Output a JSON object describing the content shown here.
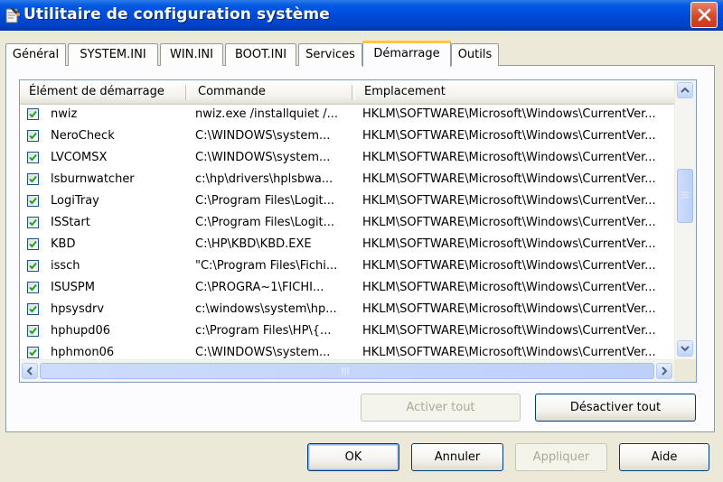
{
  "window": {
    "title": "Utilitaire de configuration système"
  },
  "tabs": [
    {
      "label": "Général"
    },
    {
      "label": "SYSTEM.INI"
    },
    {
      "label": "WIN.INI"
    },
    {
      "label": "BOOT.INI"
    },
    {
      "label": "Services"
    },
    {
      "label": "Démarrage",
      "active": true
    },
    {
      "label": "Outils"
    }
  ],
  "startup_list": {
    "columns": [
      "Élément de démarrage",
      "Commande",
      "Emplacement"
    ],
    "rows": [
      {
        "checked": true,
        "item": "nwiz",
        "command": "nwiz.exe /installquiet /...",
        "location": "HKLM\\SOFTWARE\\Microsoft\\Windows\\CurrentVer..."
      },
      {
        "checked": true,
        "item": "NeroCheck",
        "command": "C:\\WINDOWS\\system...",
        "location": "HKLM\\SOFTWARE\\Microsoft\\Windows\\CurrentVer..."
      },
      {
        "checked": true,
        "item": "LVCOMSX",
        "command": "C:\\WINDOWS\\system...",
        "location": "HKLM\\SOFTWARE\\Microsoft\\Windows\\CurrentVer..."
      },
      {
        "checked": true,
        "item": "lsburnwatcher",
        "command": "c:\\hp\\drivers\\hplsbwa...",
        "location": "HKLM\\SOFTWARE\\Microsoft\\Windows\\CurrentVer..."
      },
      {
        "checked": true,
        "item": "LogiTray",
        "command": "C:\\Program Files\\Logit...",
        "location": "HKLM\\SOFTWARE\\Microsoft\\Windows\\CurrentVer..."
      },
      {
        "checked": true,
        "item": "ISStart",
        "command": "C:\\Program Files\\Logit...",
        "location": "HKLM\\SOFTWARE\\Microsoft\\Windows\\CurrentVer..."
      },
      {
        "checked": true,
        "item": "KBD",
        "command": "C:\\HP\\KBD\\KBD.EXE",
        "location": "HKLM\\SOFTWARE\\Microsoft\\Windows\\CurrentVer..."
      },
      {
        "checked": true,
        "item": "issch",
        "command": "\"C:\\Program Files\\Fichi...",
        "location": "HKLM\\SOFTWARE\\Microsoft\\Windows\\CurrentVer..."
      },
      {
        "checked": true,
        "item": "ISUSPM",
        "command": "C:\\PROGRA~1\\FICHI...",
        "location": "HKLM\\SOFTWARE\\Microsoft\\Windows\\CurrentVer..."
      },
      {
        "checked": true,
        "item": "hpsysdrv",
        "command": "c:\\windows\\system\\hp...",
        "location": "HKLM\\SOFTWARE\\Microsoft\\Windows\\CurrentVer..."
      },
      {
        "checked": true,
        "item": "hphupd06",
        "command": "c:\\Program Files\\HP\\{...",
        "location": "HKLM\\SOFTWARE\\Microsoft\\Windows\\CurrentVer..."
      },
      {
        "checked": true,
        "item": "hphmon06",
        "command": "C:\\WINDOWS\\system...",
        "location": "HKLM\\SOFTWARE\\Microsoft\\Windows\\CurrentVer..."
      }
    ]
  },
  "buttons": {
    "enable_all": "Activer tout",
    "disable_all": "Désactiver tout",
    "ok": "OK",
    "cancel": "Annuler",
    "apply": "Appliquer",
    "help": "Aide"
  },
  "colors": {
    "titlebar": "#0049d8",
    "active_tab_accent": "#ffc83c",
    "checkbox_check": "#21a121",
    "dialog_bg": "#ece9d8"
  }
}
